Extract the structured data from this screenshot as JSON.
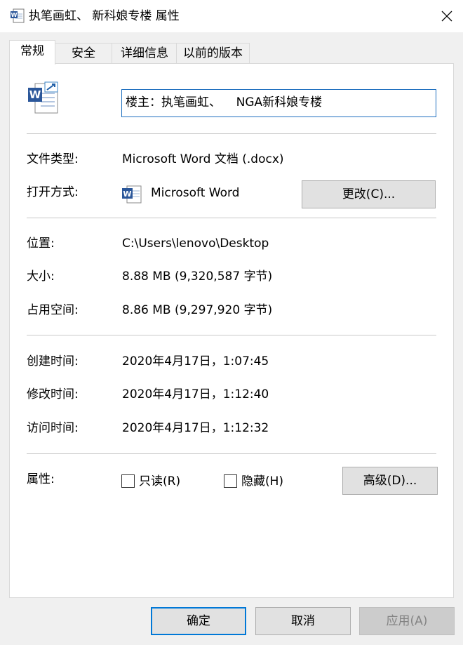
{
  "window": {
    "title": "执笔画虹、 新科娘专楼 属性",
    "close_icon": "close-icon"
  },
  "tabs": [
    {
      "label": "常规"
    },
    {
      "label": "安全"
    },
    {
      "label": "详细信息"
    },
    {
      "label": "以前的版本"
    }
  ],
  "general": {
    "file_name": "楼主：执笔画虹、    NGA新科娘专楼",
    "file_type_label": "文件类型:",
    "file_type_value": "Microsoft Word 文档 (.docx)",
    "opens_with_label": "打开方式:",
    "opens_with_value": "Microsoft Word",
    "change_button": "更改(C)...",
    "location_label": "位置:",
    "location_value": "C:\\Users\\lenovo\\Desktop",
    "size_label": "大小:",
    "size_value": "8.88 MB (9,320,587 字节)",
    "size_on_disk_label": "占用空间:",
    "size_on_disk_value": "8.86 MB (9,297,920 字节)",
    "created_label": "创建时间:",
    "created_value": "2020年4月17日，1:07:45",
    "modified_label": "修改时间:",
    "modified_value": "2020年4月17日，1:12:40",
    "accessed_label": "访问时间:",
    "accessed_value": "2020年4月17日，1:12:32",
    "attributes_label": "属性:",
    "readonly_label": "只读(R)",
    "readonly_checked": false,
    "hidden_label": "隐藏(H)",
    "hidden_checked": false,
    "advanced_button": "高级(D)..."
  },
  "footer": {
    "ok_button": "确定",
    "cancel_button": "取消",
    "apply_button": "应用(A)"
  },
  "colors": {
    "accent": "#0078d7",
    "word_blue": "#2b579a"
  }
}
